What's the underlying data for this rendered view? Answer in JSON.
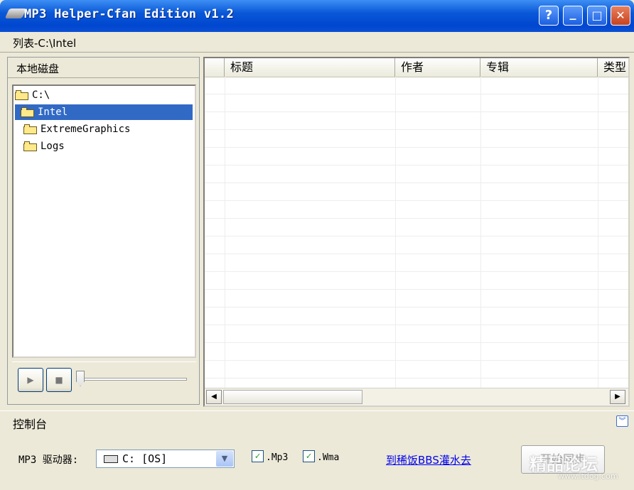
{
  "window": {
    "title": "MP3 Helper-Cfan Edition v1.2",
    "buttons": [
      "?",
      "_",
      "□",
      "✕"
    ]
  },
  "list_bar": {
    "label": "列表-C:\\Intel"
  },
  "left_panel": {
    "header": "本地磁盘",
    "tree": [
      {
        "label": "C:\\",
        "icon": "open-folder-icon",
        "selected": false
      },
      {
        "label": "Intel",
        "icon": "open-folder-icon",
        "selected": true
      },
      {
        "label": "ExtremeGraphics",
        "icon": "folder-icon",
        "selected": false
      },
      {
        "label": "Logs",
        "icon": "folder-icon",
        "selected": false
      }
    ],
    "player": {
      "play_glyph": "▶",
      "stop_glyph": "■",
      "volume": 0
    }
  },
  "grid": {
    "columns": [
      "",
      "标题",
      "作者",
      "专辑",
      "类型"
    ],
    "rows": [],
    "scroll_left": "◀",
    "scroll_right": "▶"
  },
  "console": {
    "label": "控制台",
    "collapse_glyph": "︾"
  },
  "bottom": {
    "drive_label": "MP3 驱动器:",
    "drive_value": "C: [OS]",
    "drive_dropdown_glyph": "▼",
    "checkbox_mp3": {
      "label": ".Mp3",
      "checked": true,
      "mark": "✓"
    },
    "checkbox_wma": {
      "label": ".Wma",
      "checked": true,
      "mark": "✓"
    },
    "link": "到稀饭BBS灌水去",
    "start_button": "开始同步"
  },
  "watermark": {
    "text": "精品论坛",
    "url": "www.itdog.com"
  },
  "colors": {
    "title_blue": "#0a58d8",
    "selection": "#316ac5",
    "link": "#0000ee"
  }
}
